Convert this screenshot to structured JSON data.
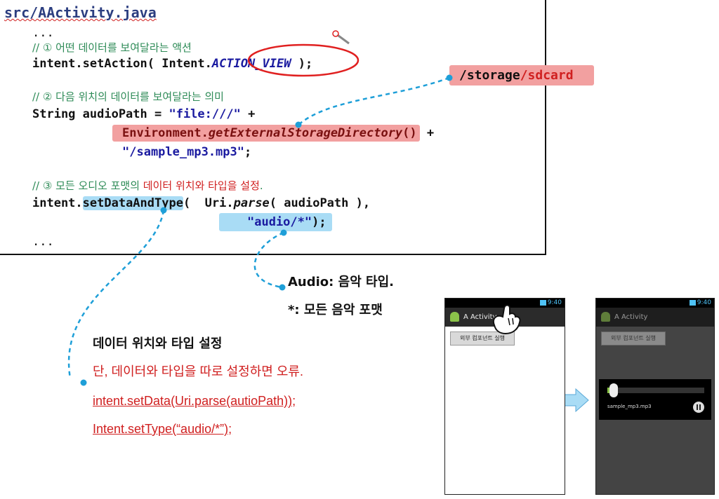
{
  "code": {
    "file_title": "src/AActivity.java",
    "ellipsis_top": "...",
    "comment1": "// ① 어떤 데이터를 보여달라는 액션",
    "line_action_pre": "intent.setAction( Intent.",
    "line_action_const": "ACTION_VIEW",
    "line_action_post": " );",
    "comment2": "// ② 다음 위치의 데이터를 보여달라는 의미",
    "line_path_pre": "String audioPath = ",
    "line_path_str": "\"file:///\"",
    "line_path_plus": " +",
    "line_env_class": "Environment.",
    "line_env_method": "getExternalStorageDirectory",
    "line_env_parens": "()",
    "line_env_plus": " +",
    "line_file_str": "\"/sample_mp3.mp3\"",
    "line_file_end": ";",
    "comment3_pre": "// ③ 모든 오디오 포맷의 ",
    "comment3_red": "데이터 위치와 타입을 설정",
    "comment3_post": ".",
    "line_set_pre": "intent.",
    "line_set_method": "setDataAndType",
    "line_set_mid": "(  Uri.",
    "line_set_parse": "parse",
    "line_set_post": "( audioPath ),",
    "line_type_str": "\"audio/*\"",
    "line_type_end": ");",
    "ellipsis_bottom": "..."
  },
  "storage_tag": {
    "black": "/storage",
    "red": "/sdcard"
  },
  "notes": {
    "audio": "Audio: 음악 타입.",
    "star": "*: 모든 음악 포맷",
    "heading": "데이터 위치와 타입 설정",
    "warning": "단, 데이터와 타입을 따로 설정하면 오류.",
    "code1": "intent.setData(Uri.parse(autioPath));",
    "code2": "Intent.setType(“audio/*”);"
  },
  "phone1": {
    "time": "9:40",
    "title": "A Activity",
    "button": "외부 컴포넌트 실행"
  },
  "phone2": {
    "time": "9:40",
    "title": "A Activity",
    "button": "외부 컴포넌트 실행",
    "track": "sample_mp3.mp3"
  },
  "colors": {
    "highlight_red": "#f2a0a0",
    "highlight_blue": "#a9dcf5",
    "connector": "#1e9fd8",
    "comment_green": "#2e8b57"
  }
}
